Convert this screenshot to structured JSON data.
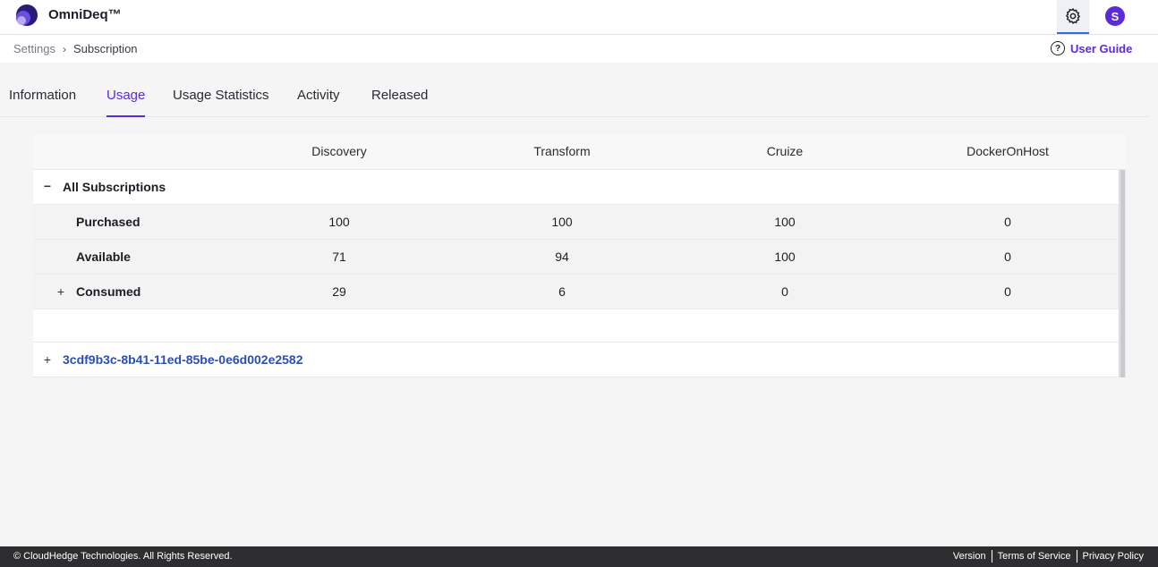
{
  "app": {
    "title": "OmniDeq™",
    "user_initial": "S"
  },
  "breadcrumb": {
    "items": [
      "Settings",
      "Subscription"
    ]
  },
  "header": {
    "user_guide_label": "User Guide"
  },
  "tabs": [
    {
      "label": "Information"
    },
    {
      "label": "Usage"
    },
    {
      "label": "Usage Statistics"
    },
    {
      "label": "Activity"
    },
    {
      "label": "Released"
    }
  ],
  "active_tab": "Usage",
  "table": {
    "columns": [
      "Discovery",
      "Transform",
      "Cruize",
      "DockerOnHost"
    ],
    "group_label": "All Subscriptions",
    "rows": [
      {
        "label": "Purchased",
        "values": [
          "100",
          "100",
          "100",
          "0"
        ]
      },
      {
        "label": "Available",
        "values": [
          "71",
          "94",
          "100",
          "0"
        ]
      },
      {
        "label": "Consumed",
        "values": [
          "29",
          "6",
          "0",
          "0"
        ]
      }
    ],
    "subscription_id": "3cdf9b3c-8b41-11ed-85be-0e6d002e2582"
  },
  "footer": {
    "copyright": "© CloudHedge Technologies. All Rights Reserved.",
    "links": [
      "Version",
      "Terms of Service",
      "Privacy Policy"
    ]
  },
  "colors": {
    "accent": "#5b2bd9",
    "link": "#2a4eb4",
    "footer_bg": "#2e2e30"
  }
}
